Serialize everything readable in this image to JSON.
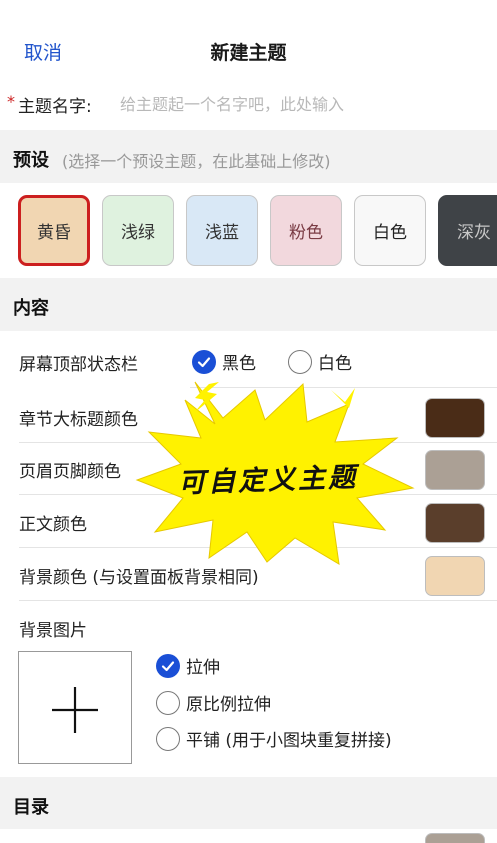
{
  "header": {
    "cancel_label": "取消",
    "title": "新建主题"
  },
  "name_field": {
    "required_mark": "*",
    "label": "主题名字:",
    "placeholder": "给主题起一个名字吧，此处输入",
    "value": ""
  },
  "presets_section": {
    "title": "预设",
    "subtitle": "(选择一个预设主题，在此基础上修改)",
    "items": [
      {
        "label": "黄昏",
        "bg": "#f1d6b2",
        "fg": "#333333",
        "selected": true
      },
      {
        "label": "浅绿",
        "bg": "#dff2df",
        "fg": "#333333",
        "selected": false
      },
      {
        "label": "浅蓝",
        "bg": "#d9e8f6",
        "fg": "#333333",
        "selected": false
      },
      {
        "label": "粉色",
        "bg": "#f2d8dd",
        "fg": "#7a3b44",
        "selected": false
      },
      {
        "label": "白色",
        "bg": "#f8f8f8",
        "fg": "#222222",
        "selected": false
      },
      {
        "label": "深灰",
        "bg": "#3f4347",
        "fg": "#c8c8c8",
        "selected": false
      }
    ],
    "selected_border": "#cc1f1f"
  },
  "content_section": {
    "title": "内容",
    "status_bar": {
      "label": "屏幕顶部状态栏",
      "options": [
        "黑色",
        "白色"
      ],
      "selected": "黑色"
    },
    "color_rows": [
      {
        "label": "章节大标题颜色",
        "color": "#4a2c17"
      },
      {
        "label": "页眉页脚颜色",
        "color": "#aba095"
      },
      {
        "label": "正文颜色",
        "color": "#5a3e2b"
      },
      {
        "label": "背景颜色 (与设置面板背景相同)",
        "color": "#f1d6b2"
      }
    ],
    "bg_image": {
      "label": "背景图片",
      "add_icon": "plus-icon",
      "options": [
        "拉伸",
        "原比例拉伸",
        "平铺 (用于小图块重复拼接)"
      ],
      "selected": "拉伸"
    }
  },
  "toc_section": {
    "title": "目录",
    "first_swatch_color": "#aba095"
  },
  "overlay": {
    "text": "可自定义主题",
    "burst_color": "#fff200"
  },
  "colors": {
    "accent": "#1a4fd6",
    "link": "#2255cc"
  }
}
